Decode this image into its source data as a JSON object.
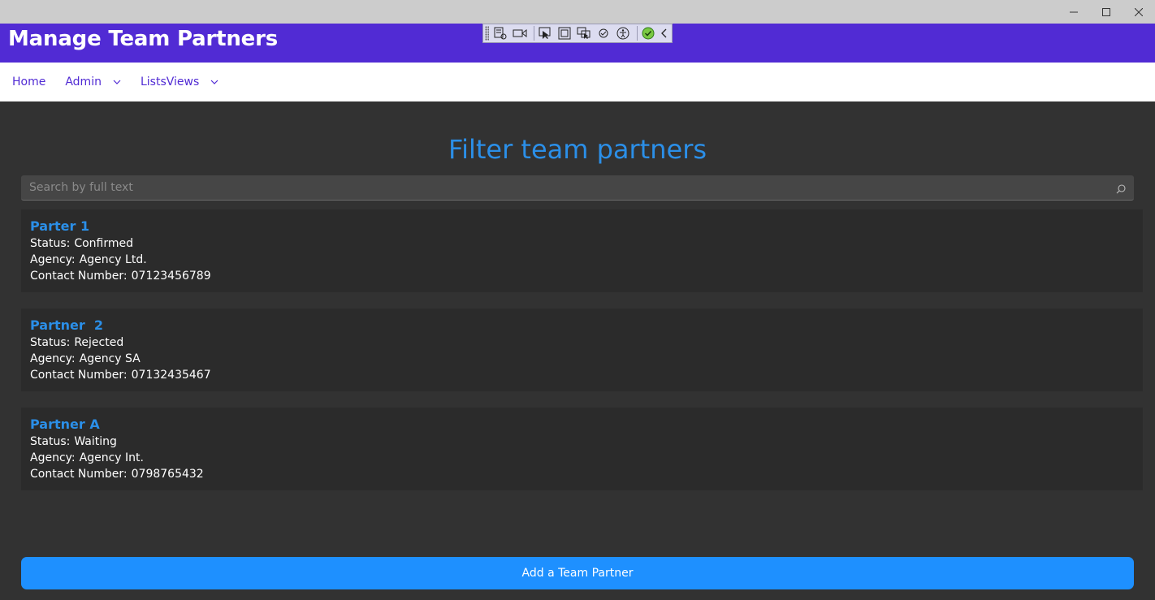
{
  "window": {
    "controls": [
      "minimize",
      "maximize",
      "close"
    ]
  },
  "header": {
    "title": "Manage Team Partners",
    "color": "#512bd4"
  },
  "nav": {
    "items": [
      {
        "label": "Home",
        "has_dropdown": false
      },
      {
        "label": "Admin",
        "has_dropdown": true
      },
      {
        "label": "ListsViews",
        "has_dropdown": true
      }
    ]
  },
  "main": {
    "heading": "Filter team partners",
    "search": {
      "placeholder": "Search by full text",
      "value": ""
    },
    "labels": {
      "status": "Status:",
      "agency": "Agency:",
      "contact": "Contact Number:"
    },
    "partners": [
      {
        "name": "Parter 1",
        "status": "Confirmed",
        "agency": "Agency Ltd.",
        "contact": "07123456789"
      },
      {
        "name": "Partner  2",
        "status": "Rejected",
        "agency": "Agency SA",
        "contact": "07132435467"
      },
      {
        "name": "Partner A",
        "status": "Waiting",
        "agency": "Agency Int.",
        "contact": "0798765432"
      }
    ],
    "add_button": "Add a Team Partner"
  },
  "colors": {
    "accent": "#2b8fe8",
    "button": "#1e90ff",
    "background": "#323232",
    "card": "#2b2b2b"
  }
}
